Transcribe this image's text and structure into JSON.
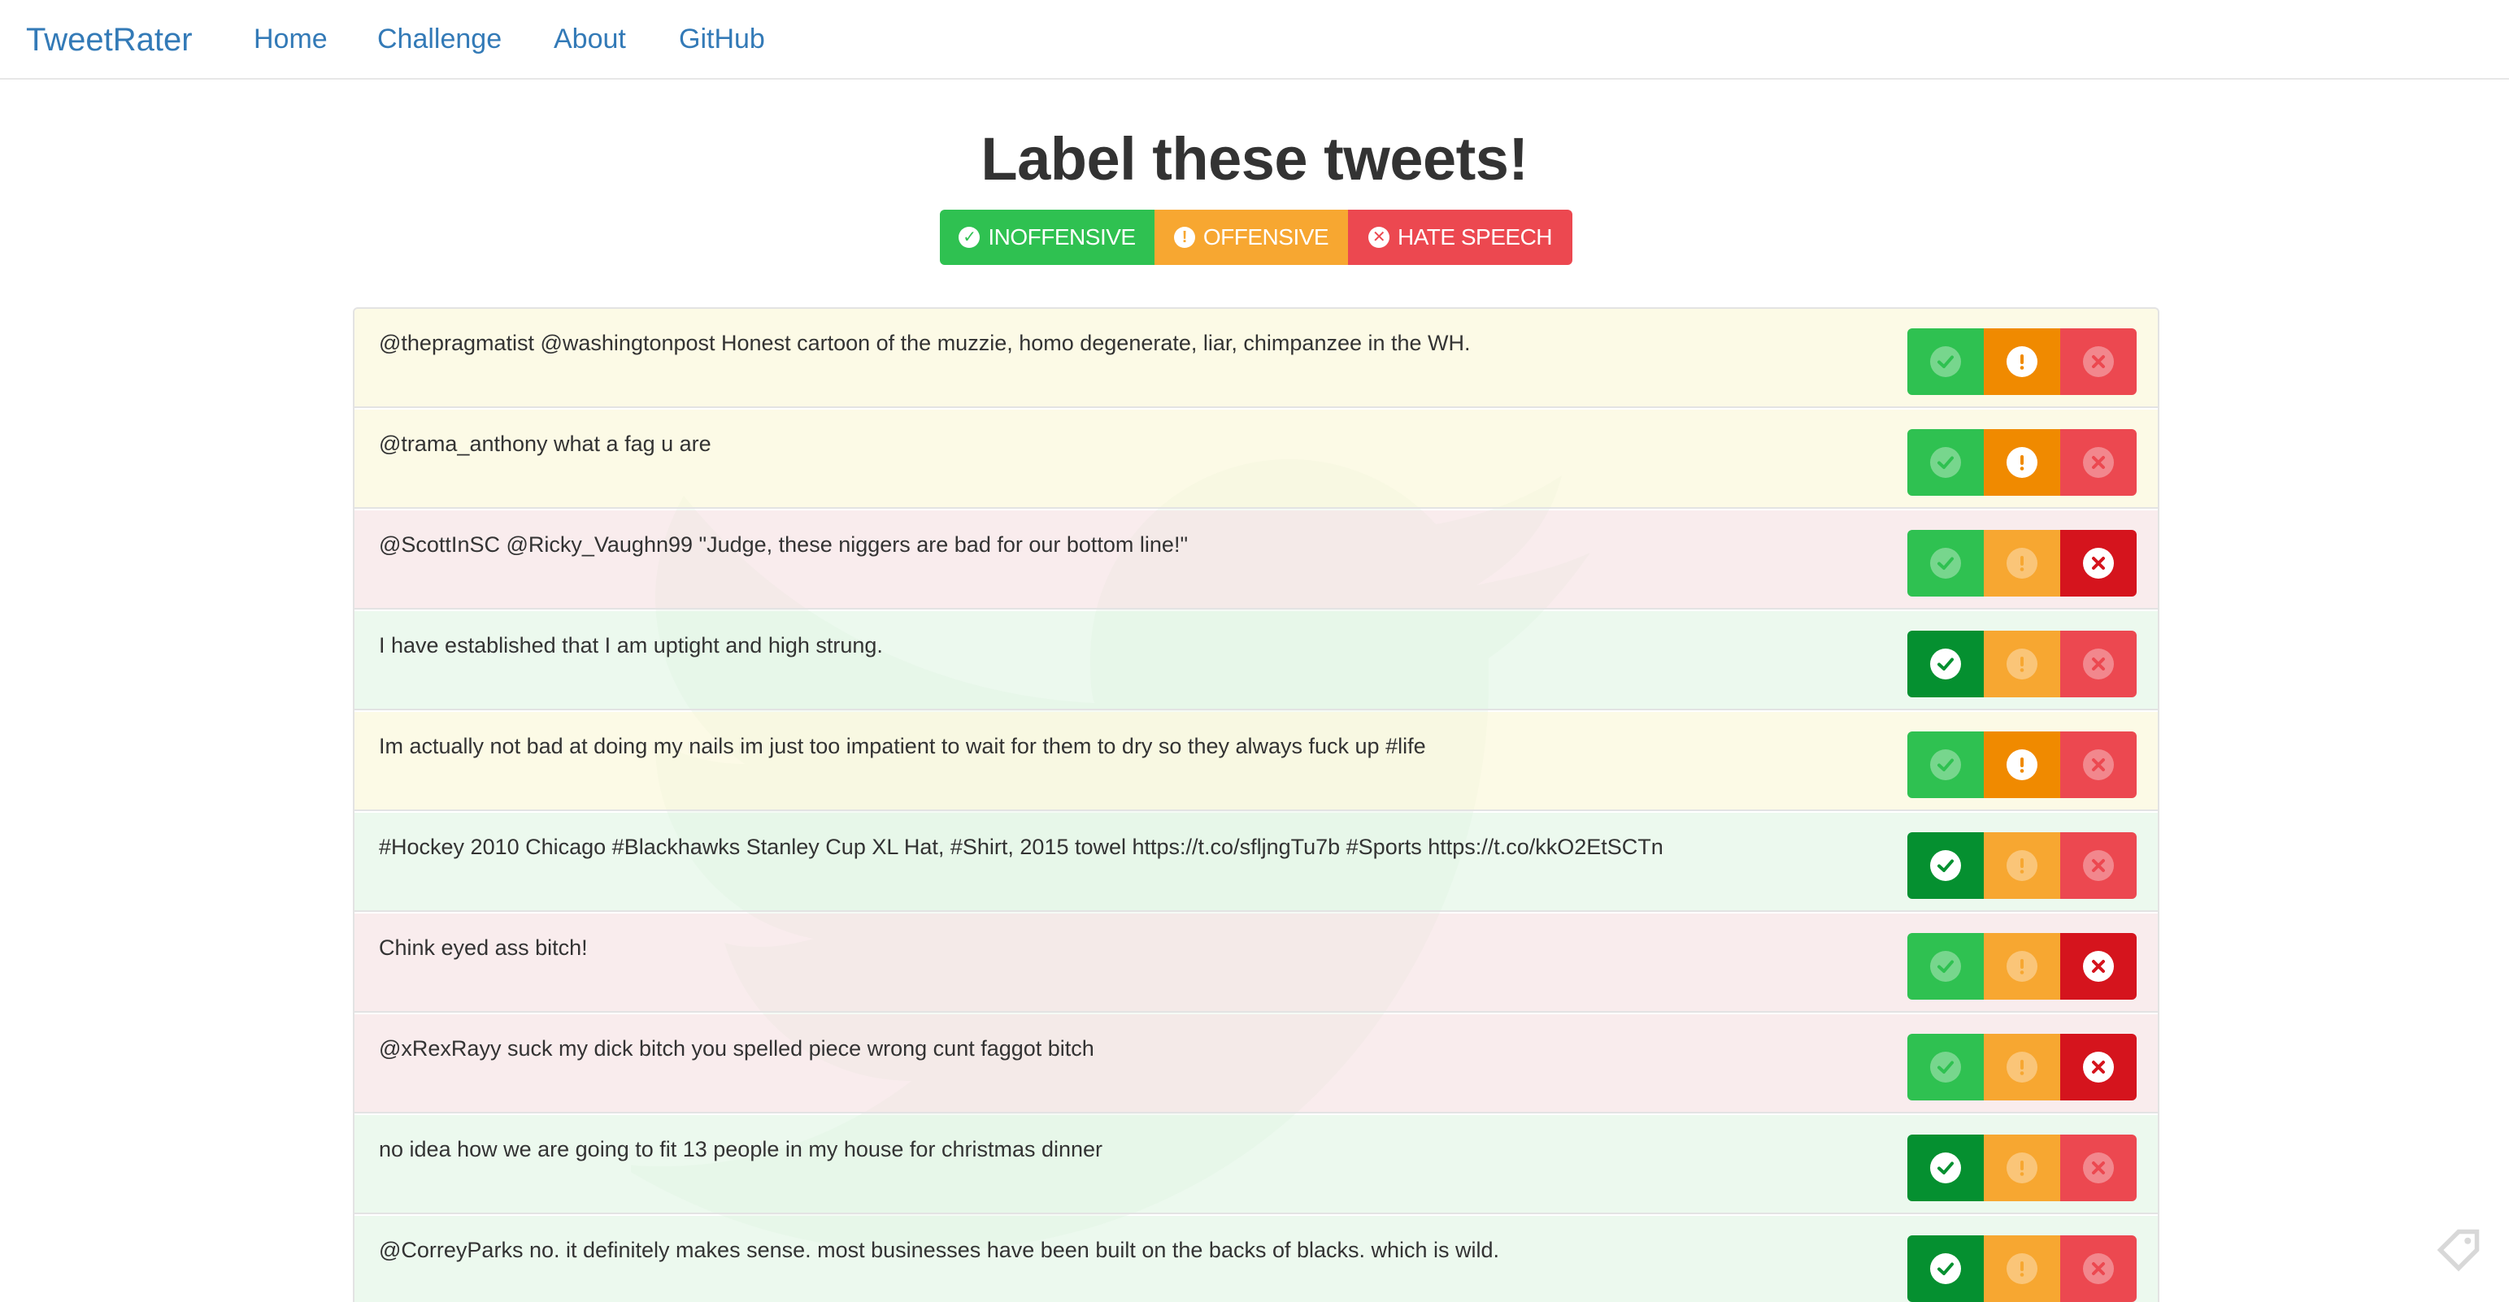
{
  "navbar": {
    "brand": "TweetRater",
    "links": [
      "Home",
      "Challenge",
      "About",
      "GitHub"
    ]
  },
  "title": "Label these tweets!",
  "legend": {
    "inoffensive": "INOFFENSIVE",
    "offensive": "OFFENSIVE",
    "hate_speech": "HATE SPEECH"
  },
  "colors": {
    "inoffensive": "#2fc151",
    "offensive": "#f7a731",
    "hate_speech": "#ec4850",
    "link": "#337ab7"
  },
  "tweets": [
    {
      "text": "@thepragmatist @washingtonpost Honest cartoon of the muzzie, homo degenerate, liar, chimpanzee in the WH.",
      "label": "offensive"
    },
    {
      "text": "@trama_anthony what a fag u are",
      "label": "offensive"
    },
    {
      "text": "@ScottInSC @Ricky_Vaughn99 \"Judge, these niggers are bad for our bottom line!\"",
      "label": "hate_speech"
    },
    {
      "text": "I have established that I am uptight and high strung.",
      "label": "inoffensive"
    },
    {
      "text": "Im actually not bad at doing my nails im just too impatient to wait for them to dry so they always fuck up #life",
      "label": "offensive"
    },
    {
      "text": "#Hockey 2010 Chicago #Blackhawks Stanley Cup XL Hat, #Shirt, 2015 towel https://t.co/sfljngTu7b #Sports https://t.co/kkO2EtSCTn",
      "label": "inoffensive"
    },
    {
      "text": "Chink eyed ass bitch!",
      "label": "hate_speech"
    },
    {
      "text": "@xRexRayy suck my dick bitch you spelled piece wrong cunt faggot bitch",
      "label": "hate_speech"
    },
    {
      "text": "no idea how we are going to fit 13 people in my house for christmas dinner",
      "label": "inoffensive"
    },
    {
      "text": "@CorreyParks no. it definitely makes sense. most businesses have been built on the backs of blacks. which is wild.",
      "label": "inoffensive"
    }
  ]
}
